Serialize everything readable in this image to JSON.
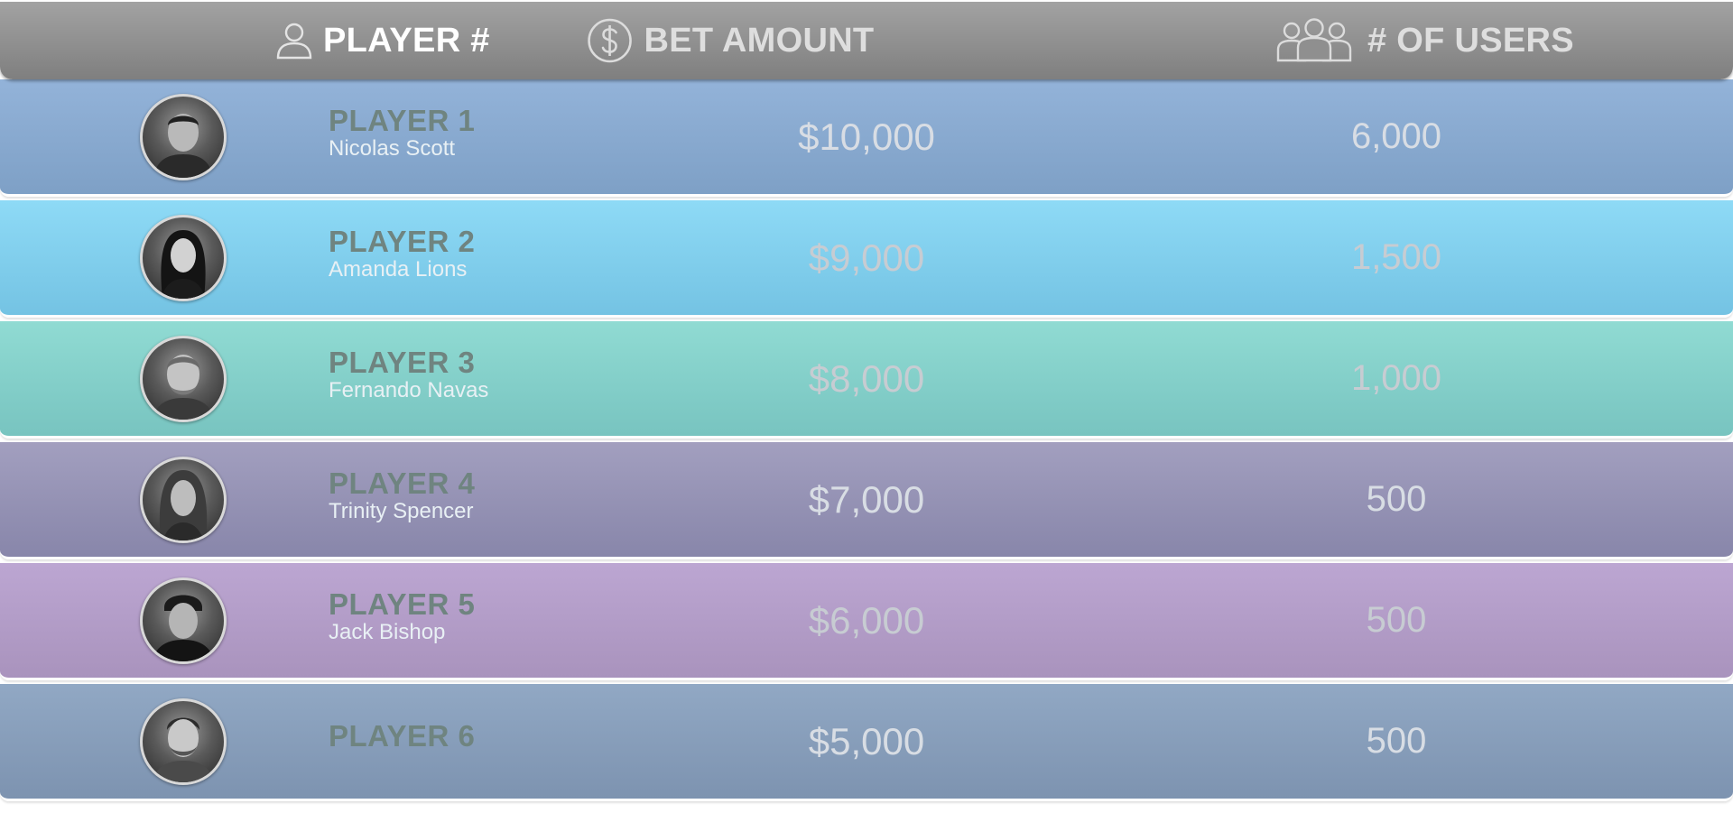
{
  "header": {
    "player_label": "PLAYER #",
    "bet_label": "BET AMOUNT",
    "users_label": "# OF USERS",
    "icons": [
      "user-icon",
      "dollar-circle-icon",
      "users-group-icon"
    ]
  },
  "rows": [
    {
      "player": "PLAYER 1",
      "name": "Nicolas Scott",
      "bet": "$10,000",
      "users": "6,000",
      "color_top": "#93b3d9",
      "color_bottom": "#7ea0c6"
    },
    {
      "player": "PLAYER 2",
      "name": "Amanda Lions",
      "bet": "$9,000",
      "users": "1,500",
      "color_top": "#8edaf6",
      "color_bottom": "#74c3e3"
    },
    {
      "player": "PLAYER 3",
      "name": "Fernando Navas",
      "bet": "$8,000",
      "users": "1,000",
      "color_top": "#90dbd3",
      "color_bottom": "#78c4c0"
    },
    {
      "player": "PLAYER 4",
      "name": "Trinity Spencer",
      "bet": "$7,000",
      "users": "500",
      "color_top": "#a29fbf",
      "color_bottom": "#8886aa"
    },
    {
      "player": "PLAYER 5",
      "name": "Jack Bishop",
      "bet": "$6,000",
      "users": "500",
      "color_top": "#bca6d2",
      "color_bottom": "#a993bd"
    },
    {
      "player": "PLAYER 6",
      "name": "",
      "bet": "$5,000",
      "users": "500",
      "color_top": "#91a8c4",
      "color_bottom": "#7d93b0"
    }
  ]
}
